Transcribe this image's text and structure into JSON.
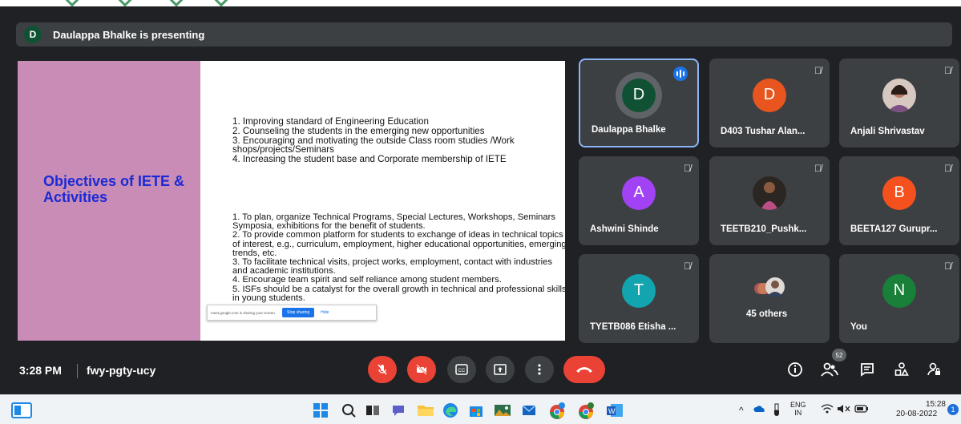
{
  "presenting_banner": {
    "avatar_letter": "D",
    "text": "Daulappa Bhalke is presenting"
  },
  "slide": {
    "title": "Objectives of IETE & Activities",
    "objectives": [
      "1. Improving standard of Engineering Education",
      "2. Counseling the students in the emerging new opportunities",
      "3. Encouraging and motivating the outside Class room studies /Work shops/projects/Seminars",
      "4. Increasing the student base and Corporate membership of IETE"
    ],
    "activities": [
      "1. To plan, organize Technical Programs, Special Lectures, Workshops, Seminars Symposia, exhibitions for the benefit of students.",
      "2. To provide common platform for students to exchange of ideas in technical topics of interest, e.g., curriculum, employment, higher educational opportunities, emerging trends, etc.",
      "3. To facilitate technical visits, project works, employment, contact with industries and academic institutions.",
      "4. Encourage team spirit and self reliance among student members.",
      "5. ISFs should be a catalyst for the overall growth in technical and professional skills in young students."
    ],
    "share_notice": "meet.google.com is sharing your screen.",
    "stop_label": "Stop sharing",
    "hide_label": "Hide"
  },
  "participants": [
    {
      "name": "Daulappa Bhalke",
      "letter": "D",
      "color": "#0f5132",
      "speaking": true
    },
    {
      "name": "D403 Tushar Alan...",
      "letter": "D",
      "color": "#e8551e"
    },
    {
      "name": "Anjali Shrivastav",
      "letter": "",
      "photo": true
    },
    {
      "name": "Ashwini Shinde",
      "letter": "A",
      "color": "#a142f4"
    },
    {
      "name": "TEETB210_Pushk...",
      "letter": "",
      "photo": true
    },
    {
      "name": "BEETA127 Gurupr...",
      "letter": "B",
      "color": "#f4511e"
    },
    {
      "name": "TYETB086 Etisha ...",
      "letter": "T",
      "color": "#12a4af"
    },
    {
      "name": "45 others",
      "letter": ""
    },
    {
      "name": "You",
      "letter": "N",
      "color": "#188038"
    }
  ],
  "controls": {
    "time": "3:28 PM",
    "meeting_code": "fwy-pgty-ucy",
    "participant_count": "52"
  },
  "taskbar": {
    "lang": "ENG",
    "region": "IN",
    "time": "15:28",
    "date": "20-08-2022",
    "notif_count": "1"
  },
  "colors": {
    "meet_bg": "#202124",
    "tile_bg": "#3c4043",
    "slide_accent": "#c88cb7",
    "end_call": "#ea4335"
  }
}
